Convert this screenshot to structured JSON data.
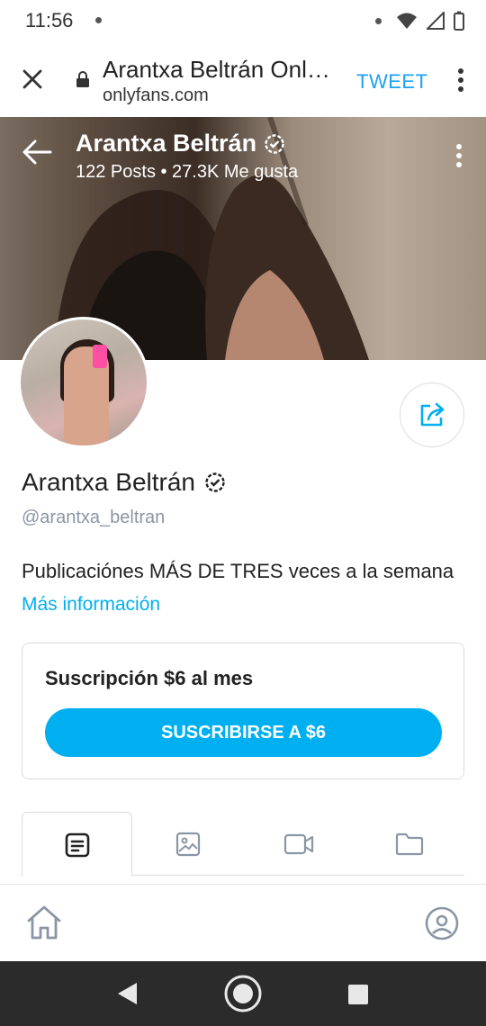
{
  "status_bar": {
    "time": "11:56"
  },
  "browser": {
    "title": "Arantxa Beltrán Onl…",
    "url": "onlyfans.com",
    "tweet_label": "TWEET"
  },
  "cover": {
    "name": "Arantxa Beltrán",
    "stats": "122 Posts • 27.3K Me gusta"
  },
  "profile": {
    "name": "Arantxa Beltrán",
    "handle": "@arantxa_beltran",
    "bio": "Publicaciónes MÁS DE TRES veces a la semana",
    "more_info": "Más información"
  },
  "subscription": {
    "title": "Suscripción $6 al mes",
    "button_label": "SUSCRIBIRSE A $6"
  },
  "tabs": [
    {
      "icon": "posts-icon"
    },
    {
      "icon": "photos-icon"
    },
    {
      "icon": "videos-icon"
    },
    {
      "icon": "archive-icon"
    }
  ],
  "colors": {
    "accent": "#00aff0",
    "tweet": "#1da1f2",
    "handle": "#8a96a3"
  }
}
